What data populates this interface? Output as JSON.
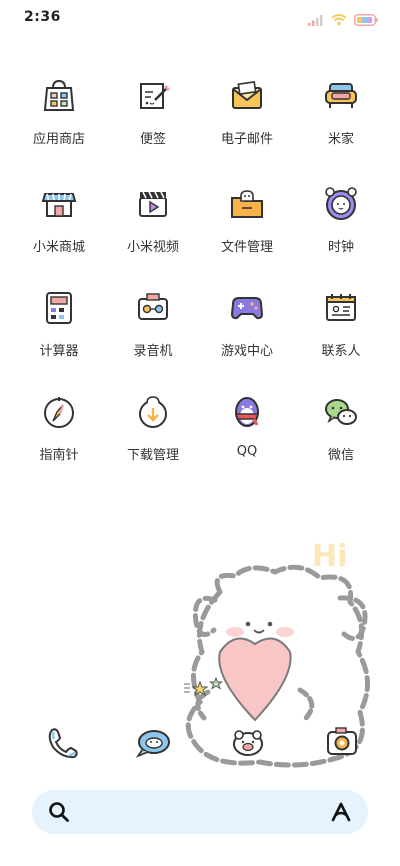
{
  "status_bar": {
    "time": "2:36"
  },
  "apps": [
    {
      "label": "应用商店",
      "icon": "app-store-bag-icon"
    },
    {
      "label": "便签",
      "icon": "notes-icon"
    },
    {
      "label": "电子邮件",
      "icon": "email-icon"
    },
    {
      "label": "米家",
      "icon": "mi-home-sofa-icon"
    },
    {
      "label": "小米商城",
      "icon": "mi-store-icon"
    },
    {
      "label": "小米视频",
      "icon": "mi-video-icon"
    },
    {
      "label": "文件管理",
      "icon": "file-manager-folder-icon"
    },
    {
      "label": "时钟",
      "icon": "clock-icon"
    },
    {
      "label": "计算器",
      "icon": "calculator-icon"
    },
    {
      "label": "录音机",
      "icon": "recorder-icon"
    },
    {
      "label": "游戏中心",
      "icon": "game-center-gamepad-icon"
    },
    {
      "label": "联系人",
      "icon": "contacts-icon"
    },
    {
      "label": "指南针",
      "icon": "compass-icon"
    },
    {
      "label": "下载管理",
      "icon": "downloads-icon"
    },
    {
      "label": "QQ",
      "icon": "qq-penguin-icon"
    },
    {
      "label": "微信",
      "icon": "wechat-icon"
    }
  ],
  "wallpaper": {
    "hi_text": "Hi"
  },
  "dock": [
    {
      "icon": "phone-icon"
    },
    {
      "icon": "messages-icon"
    },
    {
      "icon": "browser-icon"
    },
    {
      "icon": "camera-icon"
    }
  ],
  "search": {
    "placeholder": ""
  },
  "colors": {
    "search_bg": "#e7f3fc",
    "heart": "#f9c6c6",
    "accent_yellow": "#f5c95a",
    "accent_blue": "#8ec7ee",
    "accent_purple": "#8a7ae0"
  }
}
